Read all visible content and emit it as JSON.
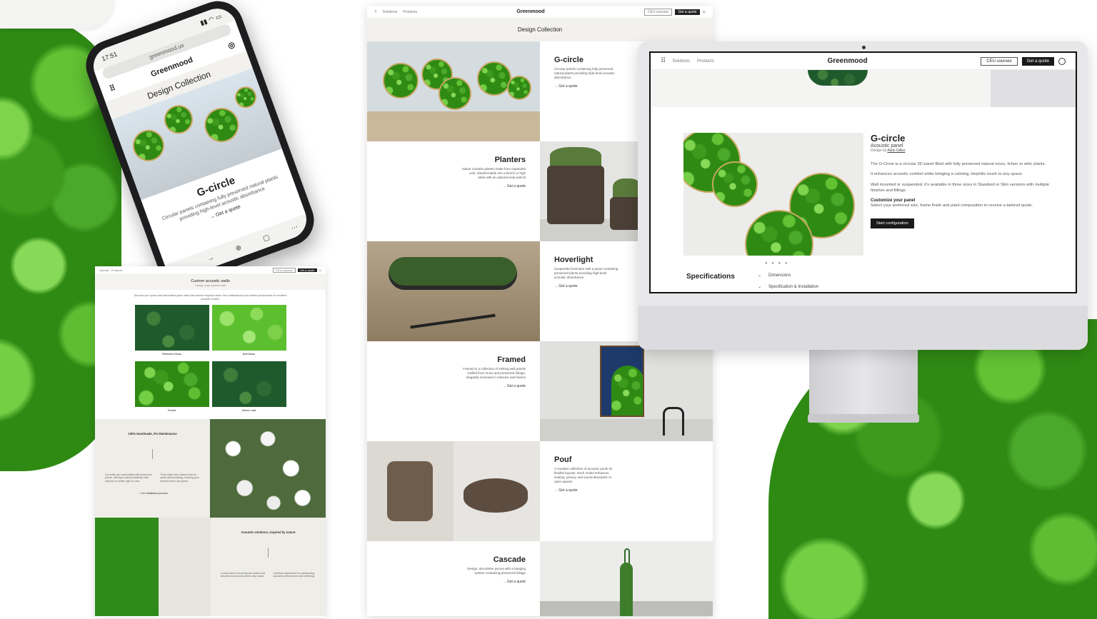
{
  "colors": {
    "moss": "#2f8a14",
    "dark": "#1a1a1a",
    "page_bg": "#ffffff",
    "beige": "#f2f1ed"
  },
  "phone": {
    "time": "17:51",
    "url": "greenmood.us",
    "brand": "Greenmood",
    "title": "Design Collection",
    "product": "G-circle",
    "description": "Circular panels containing fully preserved natural plants providing high-level acoustic absorbance",
    "cta": "Get a quote",
    "icons": [
      "back-icon",
      "forward-icon",
      "plus-icon",
      "tabs-icon",
      "more-icon"
    ]
  },
  "mini_page": {
    "nav": [
      "Special",
      "Products"
    ],
    "btn1": "CEU courses",
    "btn2": "Get a quote",
    "title": "Custom acoustic walls",
    "subtitle": "Design your perfect wall",
    "intro": "Discover your space with handcrafted green walls that combine biophilic nature, fine craftsmanship and certified performance for excellent acoustic comfort.",
    "tiles": [
      {
        "label": "Reindeer Moss",
        "style": "moss-dark"
      },
      {
        "label": "Ball Moss",
        "style": "moss-light"
      },
      {
        "label": "Forest",
        "style": "moss"
      },
      {
        "label": "Velvet Leaf",
        "style": "moss-dark"
      }
    ],
    "section1": {
      "heading": "100% Handmade, 0% Maintenance",
      "col1": "Our walls are handcrafted with preserved plants, offering a natural aesthetic that requires no water, light or care.",
      "col2": "They retain their natural look for years without fading, keeping your interiors fresh and green.",
      "link": "→ Our installation process"
    },
    "section2": {
      "heading": "Acoustic solutions, inspired by nature",
      "col1": "A wall made from preserved plants that absorbs sound and softens any space.",
      "col2": "Carefully assembled for outstanding acoustic performance and wellbeing."
    }
  },
  "design_collection": {
    "nav": [
      "Solutions",
      "Products"
    ],
    "brand": "Greenmood",
    "btn1": "CEU courses",
    "btn2": "Get a quote",
    "title": "Design Collection",
    "cta": "→ Get a quote",
    "products": [
      {
        "name": "G-circle",
        "desc": "Circular panels containing fully preserved natural plants providing high-level acoustic absorbance"
      },
      {
        "name": "Planters",
        "desc": "Indoor modular planter made from expanded cork, transformable into a bench or high table with an optional seat add kit"
      },
      {
        "name": "Hoverlight",
        "desc": "Suspended luminaire with a panel containing preserved plants providing high-level acoustic absorbance"
      },
      {
        "name": "Framed",
        "desc": "Framed is a collection of striking wall panels crafted from moss and preserved foliage, elegantly enclosed in massive oak frames"
      },
      {
        "name": "Pouf",
        "desc": "A modular collection of acoustic poufs for flexible layouts. Each model enhances seating, privacy and sound absorption in open spaces"
      },
      {
        "name": "Cascade",
        "desc": "Design, decorative pieces with a hanging system containing preserved foliage"
      }
    ]
  },
  "desktop": {
    "nav": [
      "Solutions",
      "Products"
    ],
    "brand": "Greenmood",
    "btn1": "CEU courses",
    "btn2": "Get a quote",
    "product": "G-circle",
    "subtitle": "Acoustic panel",
    "design_by_prefix": "Design by",
    "designer": "Alain Gilles",
    "p1": "The G-Circle is a circular 3D panel filled with fully preserved natural moss, lichen or wild, plants.",
    "p2": "It enhances acoustic comfort while bringing a calming, biophilic touch to any space.",
    "p3": "Wall mounted or suspended, it's available in three sizes in Standard or Slim versions with multiple finishes and fillings.",
    "customize_heading": "Customize your panel",
    "customize_text": "Select your preferred size, frame finish and plant composition to receive a tailored quote.",
    "config_button": "Start configuration",
    "carousel_dots": "● ● ● ●",
    "specs_heading": "Specifications",
    "specs": [
      "Dimensions",
      "Specification & Installation"
    ]
  }
}
